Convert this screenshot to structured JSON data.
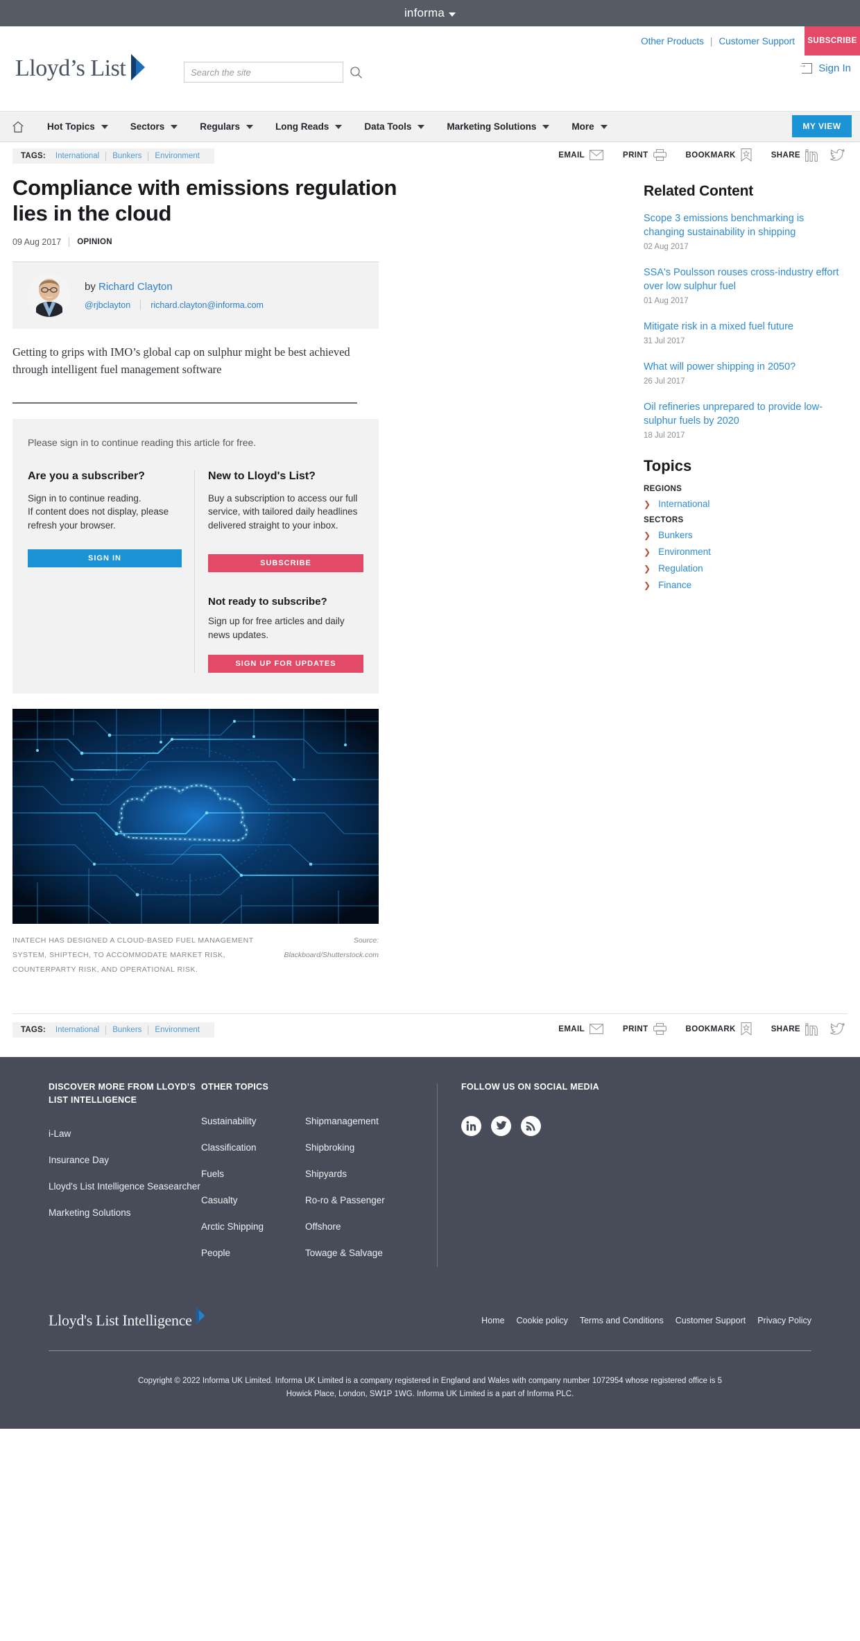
{
  "informa_bar": {
    "brand": "informa"
  },
  "masthead": {
    "logo_text": "Lloyd’s List",
    "other_products": "Other Products",
    "customer_support": "Customer Support",
    "subscribe_label": "SUBSCRIBE",
    "sign_in": "Sign In",
    "search_placeholder": "Search the site",
    "search_value": ""
  },
  "nav": {
    "items": [
      {
        "label": "Hot Topics"
      },
      {
        "label": "Sectors"
      },
      {
        "label": "Regulars"
      },
      {
        "label": "Long Reads"
      },
      {
        "label": "Data Tools"
      },
      {
        "label": "Marketing Solutions"
      },
      {
        "label": "More"
      }
    ],
    "my_view": "MY VIEW"
  },
  "tags": {
    "label": "TAGS:",
    "items": [
      "International",
      "Bunkers",
      "Environment"
    ]
  },
  "share": {
    "email": "EMAIL",
    "print": "PRINT",
    "bookmark": "BOOKMARK",
    "share": "SHARE"
  },
  "article": {
    "headline": "Compliance with emissions regulation lies in the cloud",
    "date": "09 Aug 2017",
    "kicker": "OPINION",
    "byline_prefix": "by ",
    "author": "Richard Clayton",
    "twitter": "@rjbclayton",
    "email": "richard.clayton@informa.com",
    "standfirst": "Getting to grips with IMO’s global cap on sulphur might be best achieved through intelligent fuel management software",
    "caption": "Inatech has designed a cloud-based fuel management system, Shiptech, to accommodate market risk, counterparty risk, and operational risk.",
    "source_label": "Source:",
    "source_credit": "Blackboard/Shutterstock.com"
  },
  "paywall": {
    "lead": "Please sign in to continue reading this article for free.",
    "left_heading": "Are you a subscriber?",
    "left_body": "Sign in to continue reading.\nIf content does not display, please refresh your browser.",
    "sign_in_button": "SIGN IN",
    "right_heading": "New to Lloyd's List?",
    "right_body": "Buy a subscription to access our full service, with tailored daily headlines delivered straight to your inbox.",
    "subscribe_button": "SUBSCRIBE",
    "right_heading2": "Not ready to subscribe?",
    "right_body2": "Sign up for free articles and daily news updates.",
    "signup_button": "SIGN UP FOR UPDATES"
  },
  "sidebar": {
    "related_heading": "Related Content",
    "related": [
      {
        "title": "Scope 3 emissions benchmarking is changing sustainability in shipping",
        "date": "02 Aug 2017"
      },
      {
        "title": "SSA's Poulsson rouses cross-industry effort over low sulphur fuel",
        "date": "01 Aug 2017"
      },
      {
        "title": "Mitigate risk in a mixed fuel future",
        "date": "31 Jul 2017"
      },
      {
        "title": "What will power shipping in 2050?",
        "date": "26 Jul 2017"
      },
      {
        "title": "Oil refineries unprepared to provide low-sulphur fuels by 2020",
        "date": "18 Jul 2017"
      }
    ],
    "topics_heading": "Topics",
    "topic_groups": [
      {
        "label": "REGIONS",
        "links": [
          "International"
        ]
      },
      {
        "label": "SECTORS",
        "links": [
          "Bunkers",
          "Environment",
          "Regulation",
          "Finance"
        ]
      }
    ]
  },
  "footer": {
    "col1_heading": "DISCOVER MORE FROM LLOYD’S LIST INTELLIGENCE",
    "col1_links": [
      "i-Law",
      "Insurance Day",
      "Lloyd's List Intelligence Seasearcher",
      "Marketing Solutions"
    ],
    "col2_heading": "OTHER TOPICS",
    "col2_links": [
      "Sustainability",
      "Classification",
      "Fuels",
      "Casualty",
      "Arctic Shipping",
      "People"
    ],
    "col3_links": [
      "Shipmanagement",
      "Shipbroking",
      "Shipyards",
      "Ro-ro & Passenger",
      "Offshore",
      "Towage & Salvage"
    ],
    "col4_heading": "FOLLOW US ON SOCIAL MEDIA",
    "logo_text": "Lloyd's List Intelligence",
    "bottom_links": [
      "Home",
      "Cookie policy",
      "Terms and Conditions",
      "Customer Support",
      "Privacy Policy"
    ],
    "copyright": "Copyright © 2022 Informa UK Limited. Informa UK Limited is a company registered in England and Wales with company number 1072954 whose registered office is 5 Howick Place, London, SW1P 1WG. Informa UK Limited is a part of Informa PLC."
  },
  "colors": {
    "informa_bar": "#555c63",
    "pink": "#e24a68",
    "blue": "#1b93d4",
    "link_blue": "#2e8bd4",
    "footer": "#474c58"
  }
}
